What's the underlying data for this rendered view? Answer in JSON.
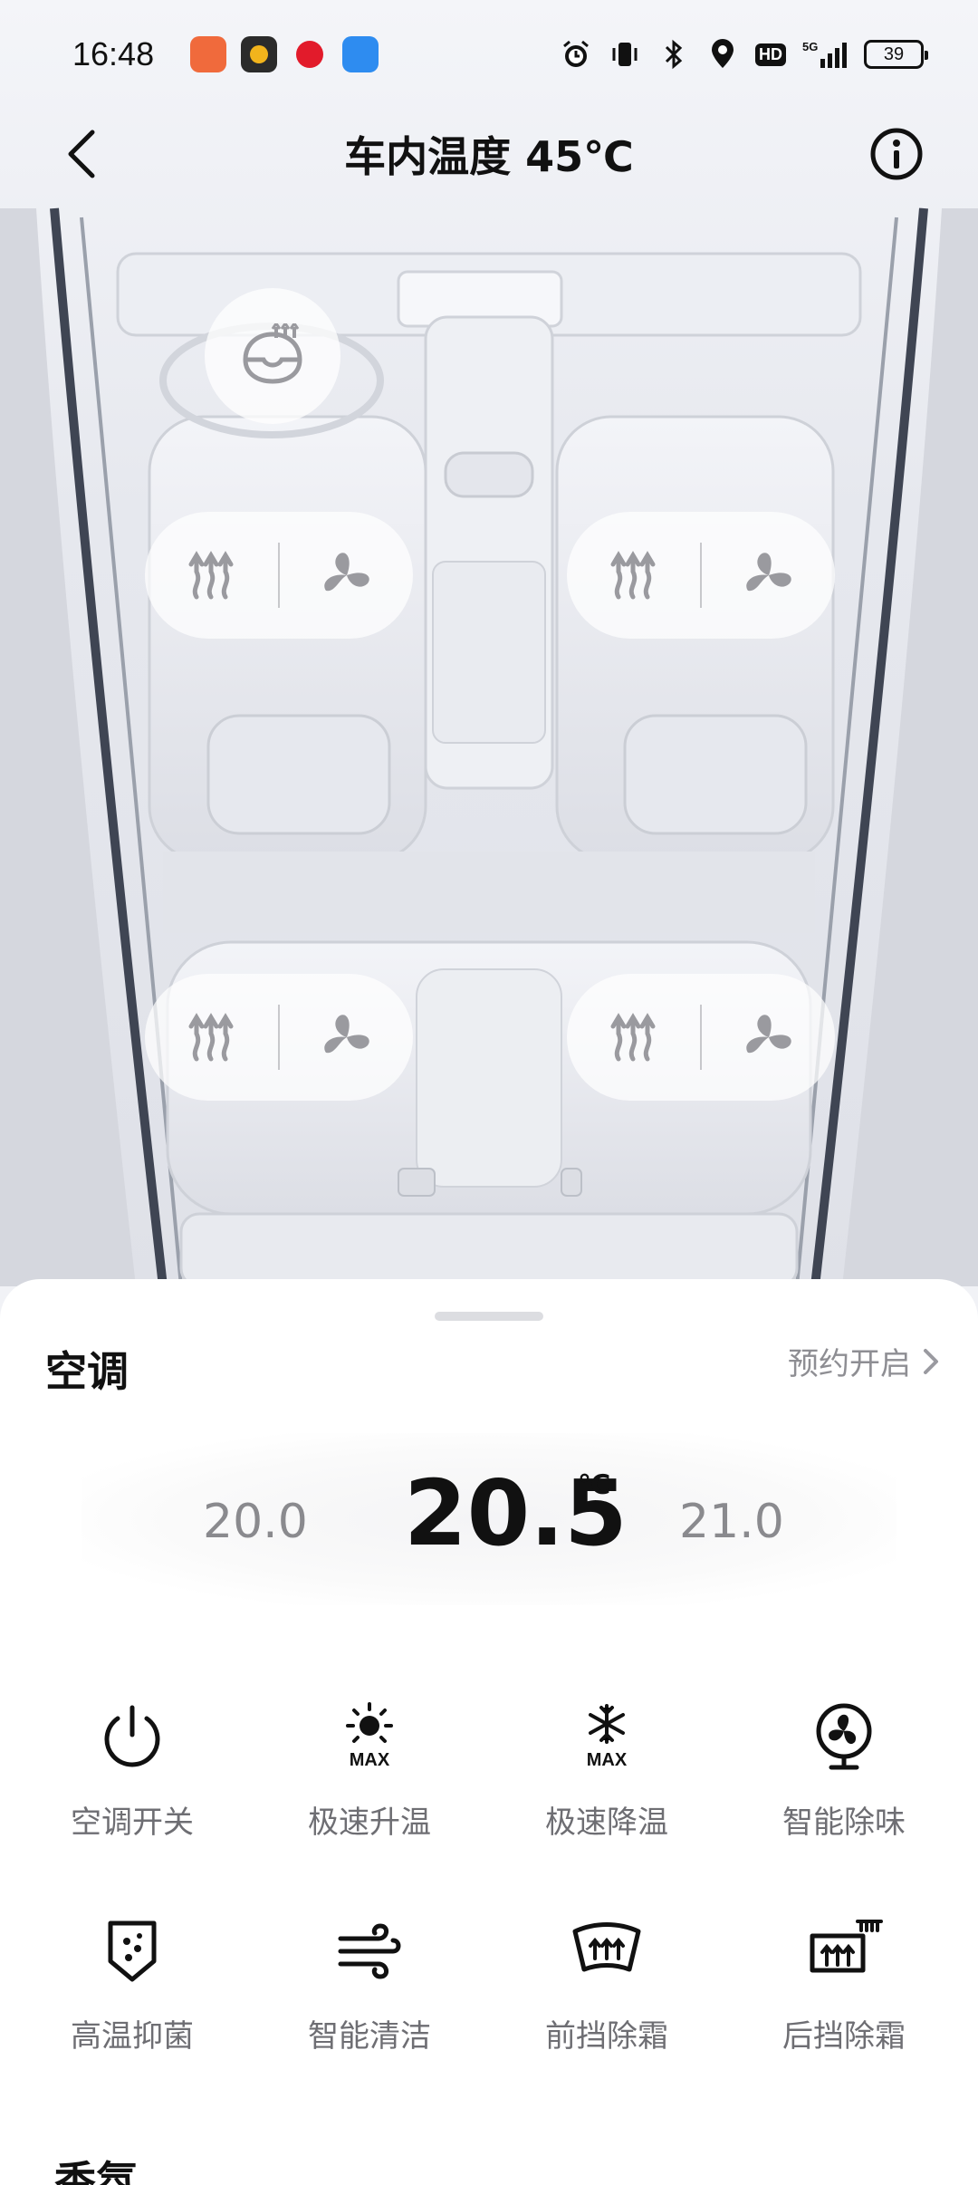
{
  "status_bar": {
    "time": "16:48",
    "battery": "39",
    "hd": "HD",
    "network": "5G",
    "app_icons": [
      "app-icon-1",
      "app-icon-2",
      "app-icon-3",
      "app-icon-4"
    ]
  },
  "header": {
    "title": "车内温度 45℃"
  },
  "seats": [
    {
      "name": "driver",
      "heat_icon": "seat-heat-icon",
      "vent_icon": "seat-ventilation-icon"
    },
    {
      "name": "front-passenger",
      "heat_icon": "seat-heat-icon",
      "vent_icon": "seat-ventilation-icon"
    },
    {
      "name": "rear-left",
      "heat_icon": "seat-heat-icon",
      "vent_icon": "seat-ventilation-icon"
    },
    {
      "name": "rear-right",
      "heat_icon": "seat-heat-icon",
      "vent_icon": "seat-ventilation-icon"
    }
  ],
  "ac": {
    "title": "空调",
    "schedule_label": "预约开启",
    "temp_prev": "20.0",
    "temp_current": "20.5",
    "temp_unit": "℃",
    "temp_next": "21.0"
  },
  "functions": [
    {
      "label": "空调开关",
      "icon": "power-icon"
    },
    {
      "label": "极速升温",
      "icon": "sun-max-icon"
    },
    {
      "label": "极速降温",
      "icon": "snow-max-icon"
    },
    {
      "label": "智能除味",
      "icon": "fan-icon"
    },
    {
      "label": "高温抑菌",
      "icon": "shield-icon"
    },
    {
      "label": "智能清洁",
      "icon": "wind-icon"
    },
    {
      "label": "前挡除霜",
      "icon": "front-defrost-icon"
    },
    {
      "label": "后挡除霜",
      "icon": "rear-defrost-icon"
    }
  ],
  "next_section_title": "香氛",
  "colors": {
    "accent": "#111111",
    "muted": "#8e8e93",
    "icon_grey": "#8a8a8e"
  }
}
